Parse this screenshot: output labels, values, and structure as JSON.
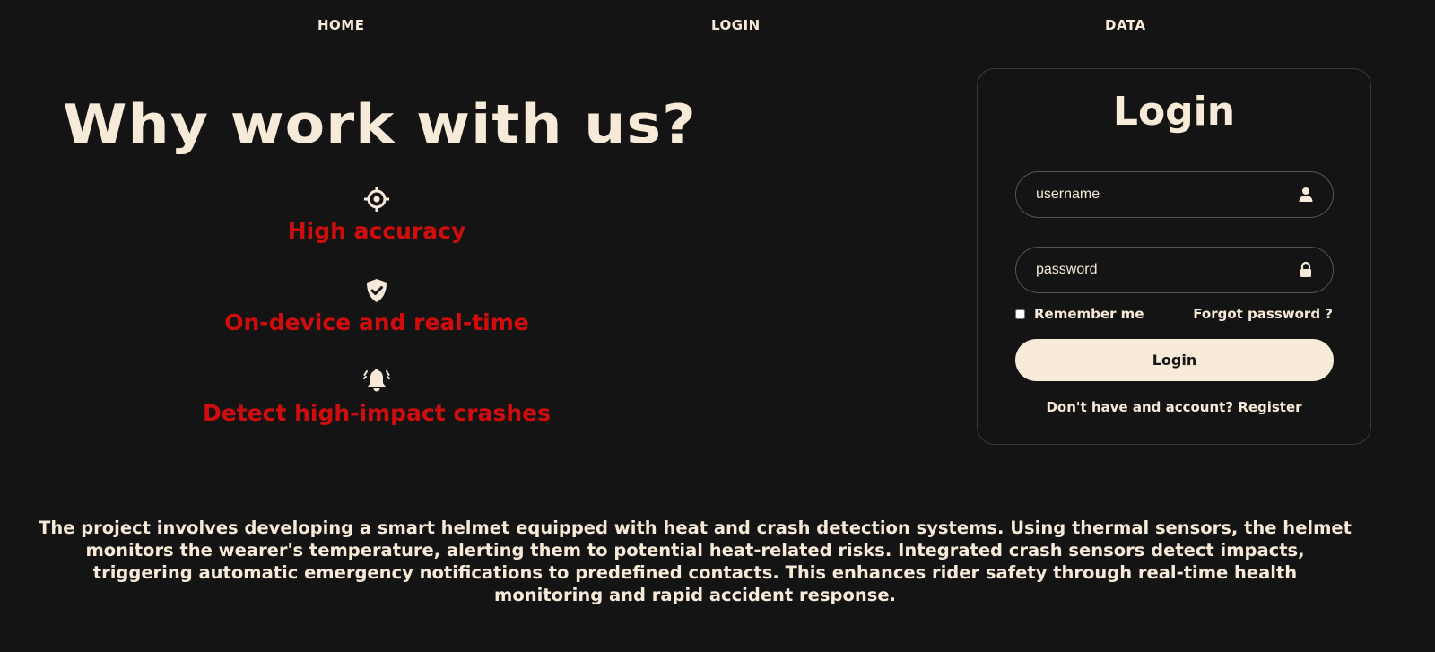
{
  "nav": {
    "items": [
      {
        "label": "HOME"
      },
      {
        "label": "LOGIN"
      },
      {
        "label": "DATA"
      }
    ]
  },
  "hero": {
    "title": "Why work with us?"
  },
  "features": [
    {
      "icon": "crosshair-icon",
      "label": "High accuracy"
    },
    {
      "icon": "shield-check-icon",
      "label": "On-device and real-time"
    },
    {
      "icon": "bell-ringing-icon",
      "label": "Detect high-impact crashes"
    }
  ],
  "login": {
    "title": "Login",
    "username_placeholder": "username",
    "username_value": "",
    "password_placeholder": "password",
    "password_value": "",
    "remember_label": "Remember me",
    "remember_checked": false,
    "forgot_label": "Forgot password ?",
    "button_label": "Login",
    "register_prompt": "Don't have and account?",
    "register_link": "Register"
  },
  "description": "The project involves developing a smart helmet equipped with heat and crash detection systems. Using thermal sensors, the helmet monitors the wearer's temperature, alerting them to potential heat-related risks. Integrated crash sensors detect impacts, triggering automatic emergency notifications to predefined contacts. This enhances rider safety through real-time health monitoring and rapid accident response.",
  "colors": {
    "background": "#141414",
    "text": "#f8ead8",
    "accent_red": "#d00d0d",
    "card_border": "#3a3a3a"
  }
}
